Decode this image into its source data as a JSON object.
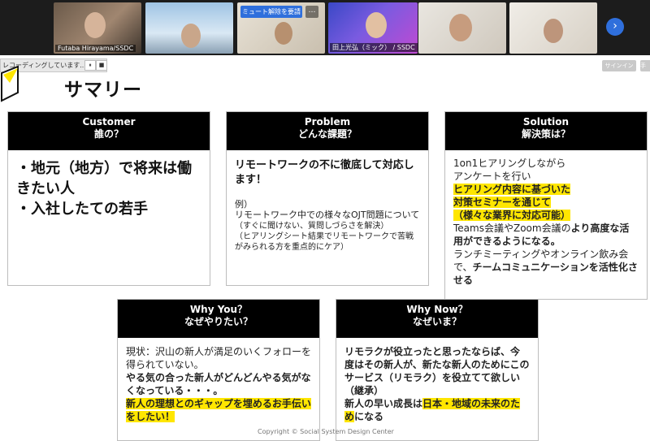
{
  "meeting": {
    "participants": [
      {
        "name": "Futaba Hirayama/SSDC"
      },
      {
        "name": ""
      },
      {
        "name": "",
        "unmute_label": "ミュート解除を要請",
        "more_label": "…"
      },
      {
        "name": "田上光弘（ミック） / SSDC"
      },
      {
        "name": ""
      },
      {
        "name": ""
      }
    ],
    "next_icon": "chevron-right-icon"
  },
  "recording": {
    "text": "レコーディングしています...",
    "pause_label": "⏸",
    "stop_label": "■"
  },
  "signin": {
    "label": "サインイン",
    "label2": "手"
  },
  "slide": {
    "title": "サマリー",
    "copyright": "Copyright © Social System Design Center",
    "customer": {
      "h1": "Customer",
      "h2": "誰の？",
      "line1": "・地元（地方）で将来は働きたい人",
      "line2": "・入社したての若手"
    },
    "problem": {
      "h1": "Problem",
      "h2": "どんな課題？",
      "main": "リモートワークの不に徹底して対応します！",
      "ex_label": "例）",
      "ex_text": "リモートワーク中での様々なOJT問題について",
      "note1": "（すぐに聞けない、質問しづらさを解決）",
      "note2": "（ヒアリングシート結果でリモートワークで苦戦がみられる方を重点的にケア）"
    },
    "solution": {
      "h1": "Solution",
      "h2": "解決策は？",
      "l1": "1on1ヒアリングしながら",
      "l2": "アンケートを行い",
      "hl1": "ヒアリング内容に基づいた",
      "hl2": "対策セミナーを通じて",
      "hl3": "（様々な業界に対応可能）",
      "t1": "Teams会議やZoom会議の",
      "t1b": "より高度な活用",
      "t1c": "ができるようになる。",
      "t2": "ランチミーティングやオンライン飲み会で、",
      "t2b": "チームコミュニケーションを活性化させる"
    },
    "whyyou": {
      "h1": "Why You？",
      "h2": "なぜやりたい？",
      "l1": "現状：沢山の新人が満足のいくフォローを得られていない。",
      "l2": "やる気の合った新人がどんどんやる気がなくなっている・・・。",
      "hl": "新人の理想とのギャップを埋めるお手伝いをしたい！"
    },
    "whynow": {
      "h1": "Why Now？",
      "h2": "なぜいま？",
      "l1a": "リモラク",
      "l1b": "が役立ったと思ったならば、今度はその新人が、新たな新人のためにこのサービス（リモラク）を役立てて欲しい（継承）",
      "l2a": "新人の早い成長は",
      "l2hl": "日本・地域の未来のため",
      "l2c": "になる"
    }
  },
  "colors": {
    "highlight": "#ffe600",
    "header": "#000000",
    "accent": "#2f6fdc"
  }
}
